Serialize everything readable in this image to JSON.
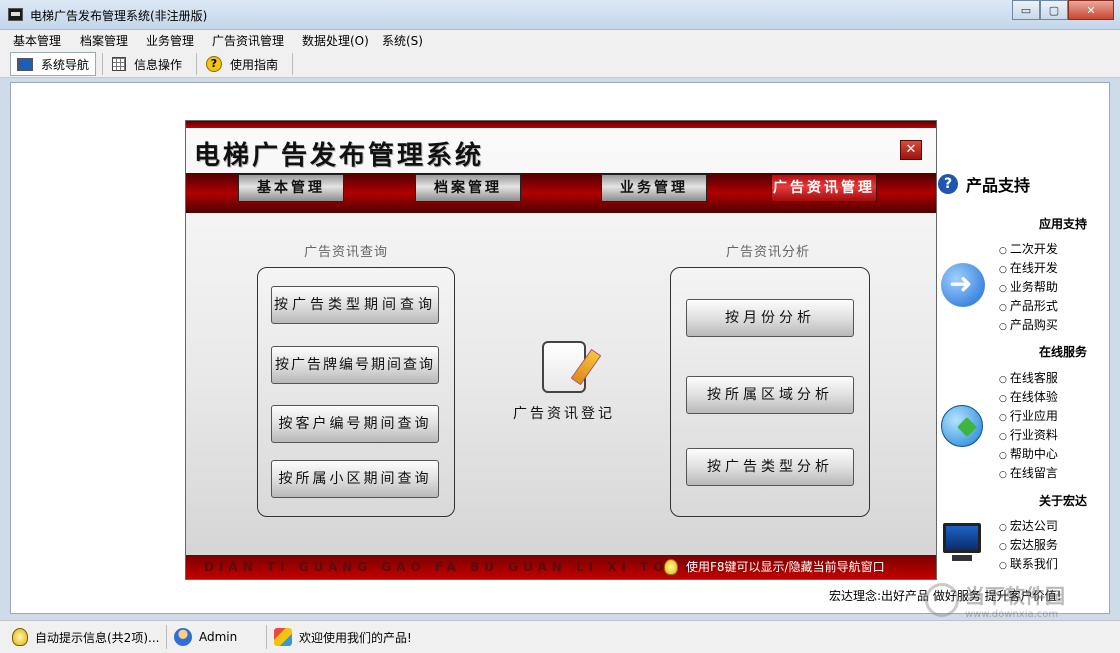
{
  "window": {
    "title": "电梯广告发布管理系统(非注册版)",
    "controls": {
      "minimize": "▭",
      "maximize": "▢",
      "close": "✕"
    }
  },
  "menubar": {
    "items": [
      {
        "label": "基本管理"
      },
      {
        "label": "档案管理"
      },
      {
        "label": "业务管理"
      },
      {
        "label": "广告资讯管理"
      },
      {
        "label": "数据处理(O)"
      },
      {
        "label": "系统(S)"
      }
    ]
  },
  "toolbar": {
    "items": [
      {
        "label": "系统导航",
        "icon": "monitor-icon",
        "active": true
      },
      {
        "label": "信息操作",
        "icon": "grid-icon"
      },
      {
        "label": "使用指南",
        "icon": "help-icon"
      }
    ]
  },
  "panel": {
    "title": "电梯广告发布管理系统",
    "close_label": "✕",
    "nav": [
      {
        "label": "基本管理"
      },
      {
        "label": "档案管理"
      },
      {
        "label": "业务管理"
      },
      {
        "label": "广告资讯管理",
        "active": true
      }
    ],
    "query_group": {
      "label": "广告资讯查询",
      "buttons": [
        {
          "label": "按广告类型期间查询"
        },
        {
          "label": "按广告牌编号期间查询"
        },
        {
          "label": "按客户编号期间查询"
        },
        {
          "label": "按所属小区期间查询"
        }
      ]
    },
    "register": {
      "label": "广告资讯登记"
    },
    "analysis_group": {
      "label": "广告资讯分析",
      "buttons": [
        {
          "label": "按月份分析"
        },
        {
          "label": "按所属区域分析"
        },
        {
          "label": "按广告类型分析"
        }
      ]
    },
    "footer": {
      "pinyin": "DIAN TI GUANG GAO FA BU GUAN LI XI TONG",
      "tip": "使用F8键可以显示/隐藏当前导航窗口"
    }
  },
  "sidebar": {
    "heading": "产品支持",
    "help_glyph": "?",
    "sections": [
      {
        "title": "应用支持",
        "items": [
          "二次开发",
          "在线开发",
          "业务帮助",
          "产品形式",
          "产品购买"
        ]
      },
      {
        "title": "在线服务",
        "items": [
          "在线客服",
          "在线体验",
          "行业应用",
          "行业资料",
          "帮助中心",
          "在线留言"
        ]
      },
      {
        "title": "关于宏达",
        "items": [
          "宏达公司",
          "宏达服务",
          "联系我们"
        ]
      }
    ],
    "motto": "宏达理念:出好产品 做好服务 提升客户价值!"
  },
  "watermark": {
    "text": "当下软件园",
    "url": "www.downxia.com"
  },
  "statusbar": {
    "cells": [
      {
        "label": "自动提示信息(共2项)...",
        "icon": "bulb-icon"
      },
      {
        "label": "Admin",
        "icon": "user-icon"
      },
      {
        "label": "欢迎使用我们的产品!",
        "icon": "box-icon"
      }
    ]
  },
  "colors": {
    "accent_red": "#b10000",
    "titlebar": "#c4d6ea",
    "link_blue": "#1f56b3"
  }
}
